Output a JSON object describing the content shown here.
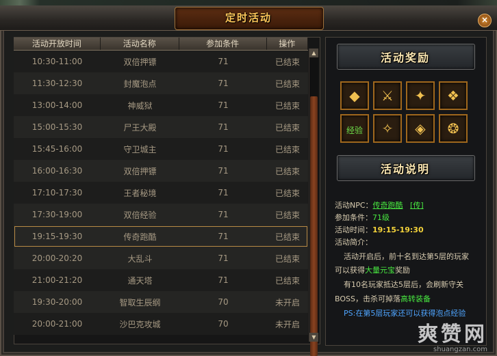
{
  "window": {
    "title": "定时活动",
    "close_label": "×"
  },
  "table": {
    "headers": [
      "活动开放时间",
      "活动名称",
      "参加条件",
      "操作"
    ],
    "rows": [
      [
        "10:30-11:00",
        "双倍押镖",
        "71",
        "已结束"
      ],
      [
        "11:30-12:30",
        "封魔泡点",
        "71",
        "已结束"
      ],
      [
        "13:00-14:00",
        "神威狱",
        "71",
        "已结束"
      ],
      [
        "15:00-15:30",
        "尸王大殿",
        "71",
        "已结束"
      ],
      [
        "15:45-16:00",
        "守卫城主",
        "71",
        "已结束"
      ],
      [
        "16:00-16:30",
        "双倍押镖",
        "71",
        "已结束"
      ],
      [
        "17:10-17:30",
        "王者秘境",
        "71",
        "已结束"
      ],
      [
        "17:30-19:00",
        "双倍经验",
        "71",
        "已结束"
      ],
      [
        "19:15-19:30",
        "传奇跑酷",
        "71",
        "已结束"
      ],
      [
        "20:00-20:20",
        "大乱斗",
        "71",
        "已结束"
      ],
      [
        "21:00-21:20",
        "通天塔",
        "71",
        "已结束"
      ],
      [
        "19:30-20:00",
        "智取生辰纲",
        "70",
        "未开启"
      ],
      [
        "20:00-21:00",
        "沙巴克攻城",
        "70",
        "未开启"
      ]
    ],
    "selected_index": 8
  },
  "scrollbar": {
    "up": "▲",
    "down": "▼"
  },
  "rewards": {
    "title": "活动奖励",
    "items": [
      {
        "icon": "gold-ingot-icon",
        "glyph": "◆"
      },
      {
        "icon": "sword-icon",
        "glyph": "⚔"
      },
      {
        "icon": "blade-icon",
        "glyph": "✦"
      },
      {
        "icon": "wing-icon",
        "glyph": "❖"
      },
      {
        "icon": "exp-orb-icon",
        "glyph": "经验"
      },
      {
        "icon": "armor-icon",
        "glyph": "✧"
      },
      {
        "icon": "purple-gem-icon",
        "glyph": "◈"
      },
      {
        "icon": "bracelet-icon",
        "glyph": "❂"
      }
    ]
  },
  "description": {
    "title": "活动说明",
    "npc_label": "活动NPC：",
    "npc_name": "传奇跑酷",
    "npc_link": "[传]",
    "cond_label": "参加条件：",
    "cond_value": "71级",
    "time_label": "活动时间：",
    "time_value": "19:15-19:30",
    "intro_label": "活动简介：",
    "line1": "活动开启后，前十名到达第5层的玩家",
    "line2a": "可以获得",
    "line2b": "大量元宝",
    "line2c": "奖励",
    "line3": "有10名玩家抵达5层后，会刷新守关",
    "line4a": "BOSS，击杀可掉落",
    "line4b": "高转装备",
    "line5": "PS:在第5层玩家还可以获得泡点经验"
  },
  "watermark": {
    "big": "爽赞网",
    "small": "shuangzan.com"
  }
}
